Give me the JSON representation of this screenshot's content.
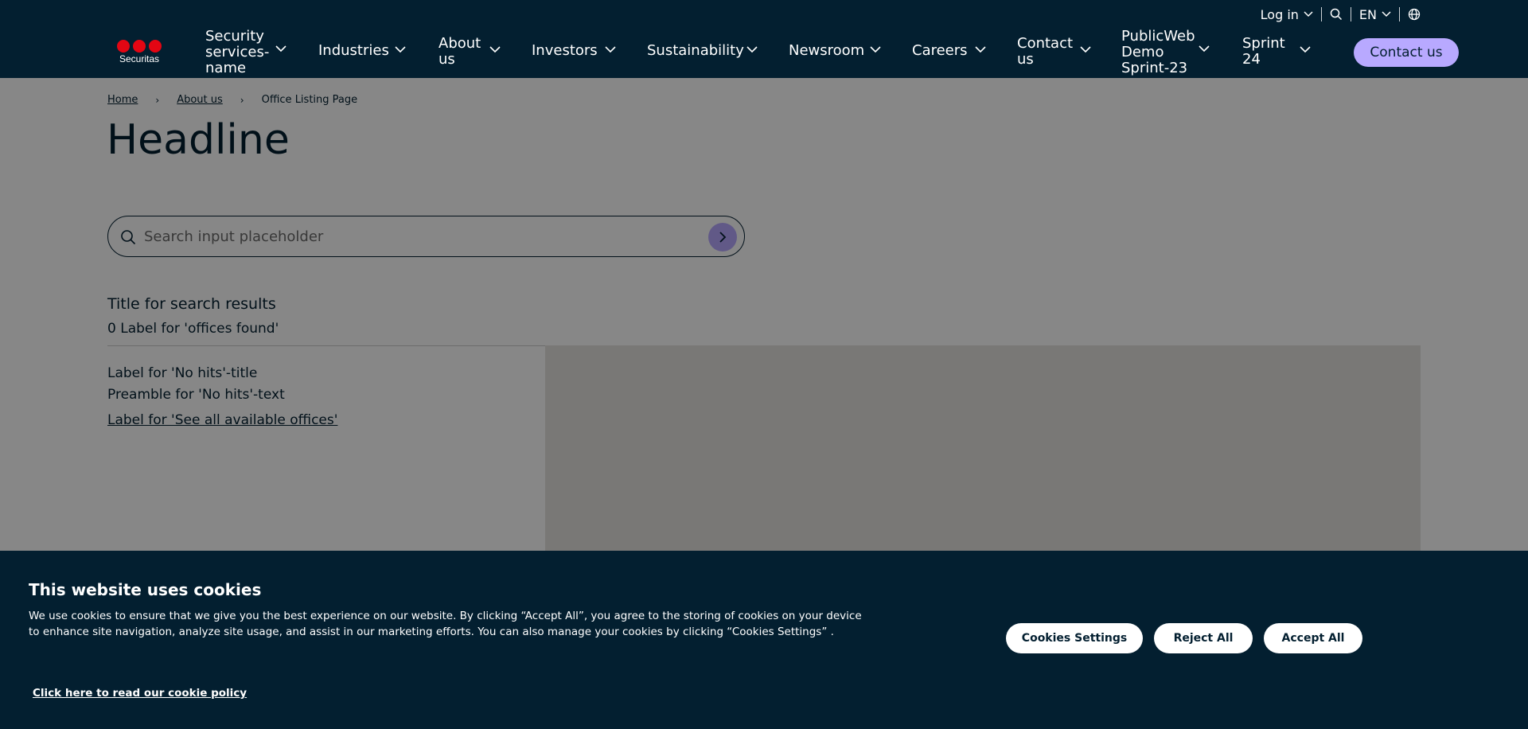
{
  "header": {
    "logo_text": "Securitas",
    "utility": {
      "login_label": "Log in",
      "language_label": "EN"
    },
    "nav": [
      {
        "label": "Security\nservices-\nname"
      },
      {
        "label": "Industries"
      },
      {
        "label": "About\nus"
      },
      {
        "label": "Investors"
      },
      {
        "label": "Sustainability"
      },
      {
        "label": "Newsroom"
      },
      {
        "label": "Careers"
      },
      {
        "label": "Contact\nus"
      },
      {
        "label": "PublicWeb\nDemo\nSprint-23"
      },
      {
        "label": "Sprint\n24"
      }
    ],
    "contact_button": "Contact us"
  },
  "breadcrumb": {
    "items": [
      "Home",
      "About us",
      "Office Listing Page"
    ],
    "separator": "›"
  },
  "page": {
    "headline": "Headline",
    "search_placeholder": "Search input placeholder",
    "results_title": "Title for search results",
    "results_count": "0 Label for 'offices found'",
    "no_hits_title": "Label for 'No hits'-title",
    "no_hits_text": "Preamble for 'No hits'-text",
    "see_all_link": "Label for 'See all available offices'"
  },
  "cookie_banner": {
    "title": "This website uses cookies",
    "text": "We use cookies to ensure that we give you the best experience on our website. By clicking “Accept All”, you agree to the storing of cookies on your device to enhance site navigation, analyze site usage, and assist in our marketing efforts. You can also manage your cookies by clicking “Cookies Settings” .",
    "settings_button": "Cookies Settings",
    "reject_button": "Reject All",
    "accept_button": "Accept All",
    "policy_link": "Click here to read our cookie policy"
  },
  "colors": {
    "header_bg": "#031F30",
    "accent": "#B8A9FF",
    "logo_red": "#E30613"
  }
}
